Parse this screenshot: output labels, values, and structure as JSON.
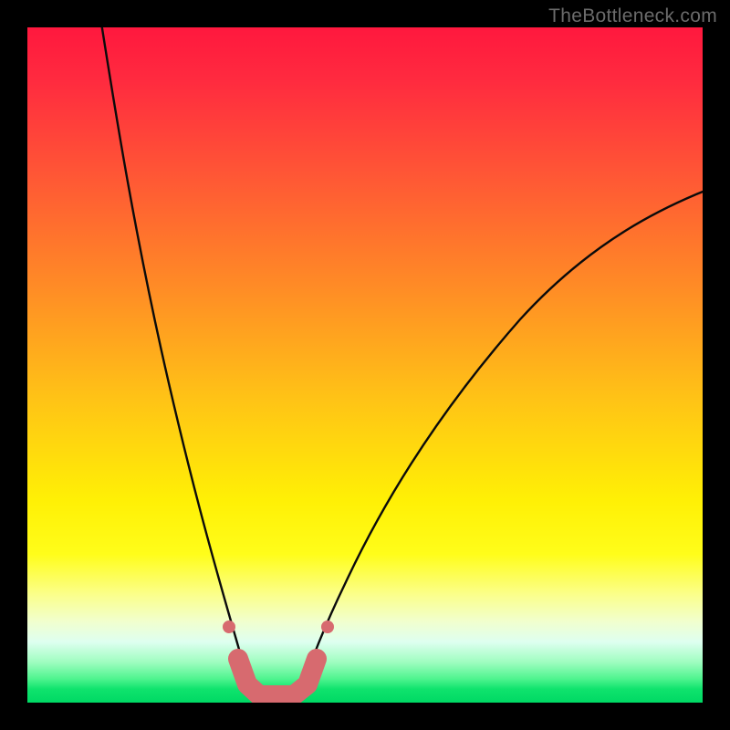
{
  "watermark": "TheBottleneck.com",
  "colors": {
    "background": "#000000",
    "curve_stroke": "#0b0b0b",
    "worm": "#d76a6f",
    "gradient_top": "#ff183e",
    "gradient_bottom": "#00d964"
  },
  "chart_data": {
    "type": "line",
    "title": "",
    "xlabel": "",
    "ylabel": "",
    "xlim": [
      0,
      100
    ],
    "ylim": [
      0,
      100
    ],
    "grid": false,
    "series": [
      {
        "name": "left-curve",
        "x": [
          11,
          14,
          17,
          20,
          23,
          25,
          27,
          29,
          30.5,
          32,
          33.5
        ],
        "y": [
          100,
          86,
          72,
          58,
          44,
          33,
          23,
          14,
          8,
          3,
          0
        ]
      },
      {
        "name": "right-curve",
        "x": [
          40,
          43,
          47,
          52,
          58,
          65,
          74,
          84,
          95,
          100
        ],
        "y": [
          0,
          5,
          12,
          22,
          33,
          44,
          55,
          64,
          72,
          76
        ]
      }
    ],
    "annotations": [
      {
        "name": "valley-worm",
        "shape": "polyline",
        "points_x": [
          31.2,
          32.5,
          34.5,
          37,
          39.5,
          41.5,
          42.9
        ],
        "points_y": [
          6.5,
          2.3,
          0.9,
          0.9,
          0.9,
          2.3,
          6.5
        ],
        "stroke_width_percent": 3
      },
      {
        "name": "bead-left",
        "shape": "circle",
        "cx": 29.8,
        "cy": 11.2,
        "r_percent": 0.9
      },
      {
        "name": "bead-right",
        "shape": "circle",
        "cx": 44.5,
        "cy": 11.2,
        "r_percent": 0.9
      }
    ],
    "background_gradient": {
      "direction": "top-to-bottom",
      "stops": [
        {
          "offset": 0.0,
          "color": "#ff183e"
        },
        {
          "offset": 0.55,
          "color": "#ffc316"
        },
        {
          "offset": 0.8,
          "color": "#fbff8b"
        },
        {
          "offset": 1.0,
          "color": "#00d964"
        }
      ]
    }
  }
}
